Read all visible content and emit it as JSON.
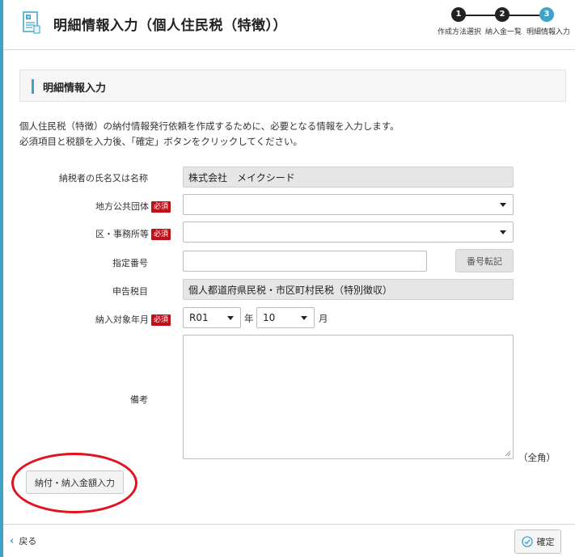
{
  "header": {
    "title": "明細情報入力（個人住民税（特徴））",
    "steps": [
      {
        "number": "1",
        "label": "作成方法選択"
      },
      {
        "number": "2",
        "label": "納入金一覧"
      },
      {
        "number": "3",
        "label": "明細情報入力"
      }
    ],
    "accent_color": "#3ea2c9"
  },
  "section": {
    "title": "明細情報入力",
    "description_line1": "個人住民税（特徴）の納付情報発行依頼を作成するために、必要となる情報を入力します。",
    "description_line2": "必須項目と税額を入力後、「確定」ボタンをクリックしてください。"
  },
  "form": {
    "required_badge": "必須",
    "taxpayer": {
      "label": "納税者の氏名又は名称",
      "value": "株式会社　メイクシード"
    },
    "local_gov": {
      "label": "地方公共団体",
      "value": ""
    },
    "ward_office": {
      "label": "区・事務所等",
      "value": ""
    },
    "designated_number": {
      "label": "指定番号",
      "value": "",
      "button": "番号転記"
    },
    "tax_item": {
      "label": "申告税目",
      "value": "個人都道府県民税・市区町村民税（特別徴収）"
    },
    "payment_period": {
      "label": "納入対象年月",
      "year_value": "R01",
      "year_unit": "年",
      "month_value": "10",
      "month_unit": "月"
    },
    "remarks": {
      "label": "備考",
      "note": "（全角）",
      "value": ""
    }
  },
  "actions": {
    "amount_input_button": "納付・納入金額入力"
  },
  "footer": {
    "back_label": "戻る",
    "confirm_label": "確定"
  }
}
